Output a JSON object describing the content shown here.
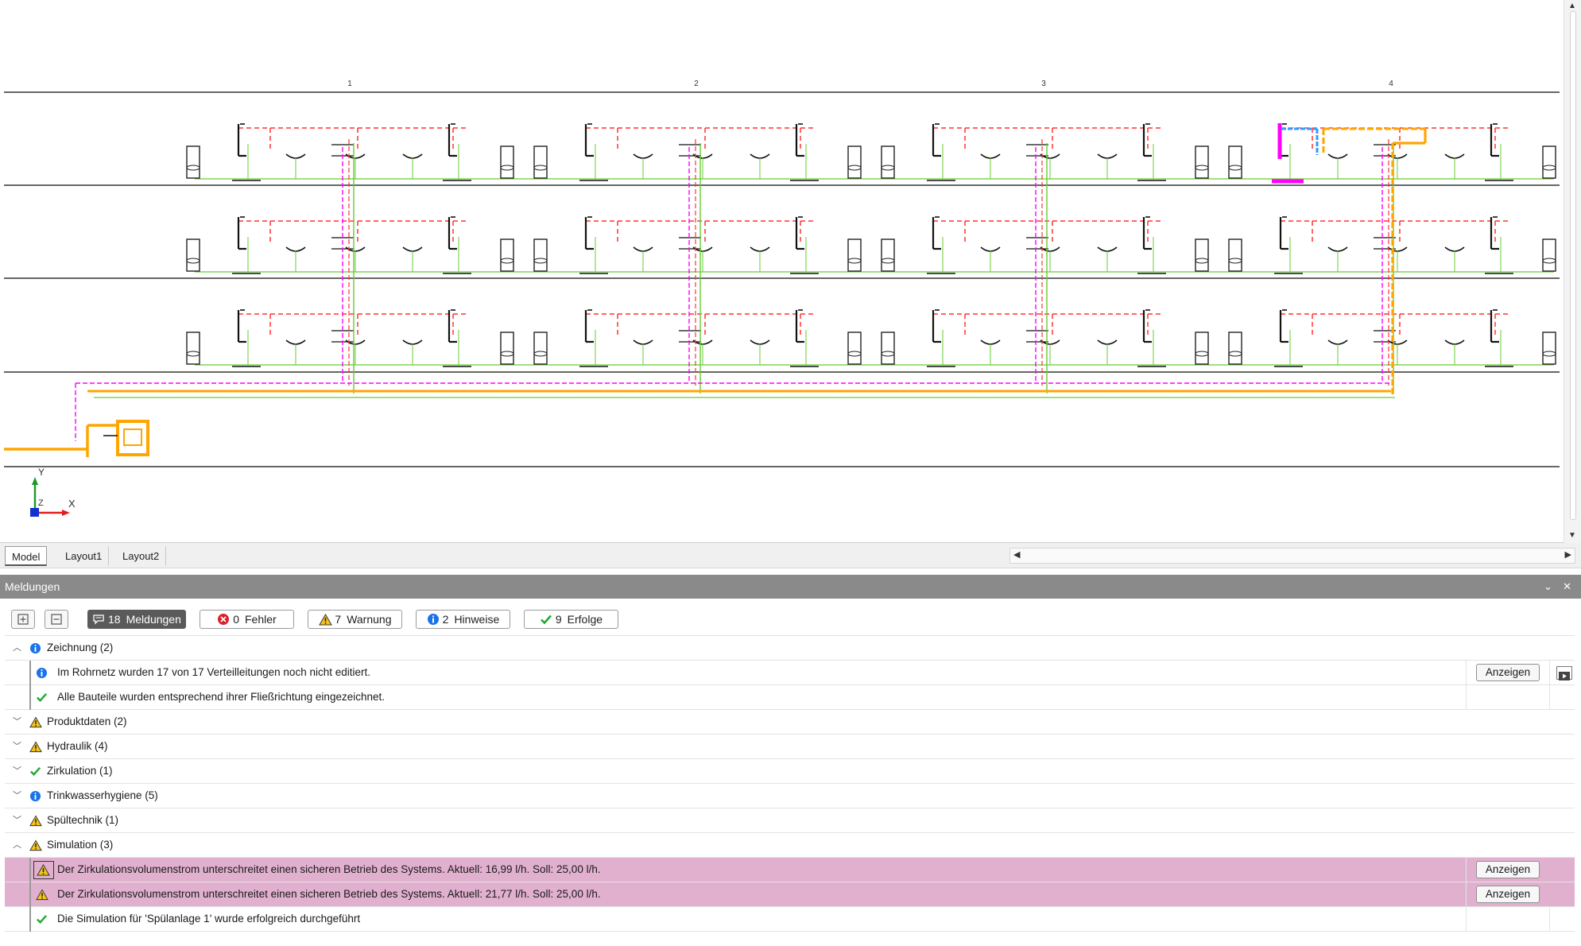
{
  "drawing": {
    "axis_labels": [
      "1",
      "2",
      "3",
      "4"
    ],
    "ucs_x": "X",
    "ucs_y": "Y",
    "ucs_z": "Z"
  },
  "layout_tabs": [
    {
      "label": "Model",
      "active": true
    },
    {
      "label": "Layout1",
      "active": false
    },
    {
      "label": "Layout2",
      "active": false
    }
  ],
  "panel": {
    "title": "Meldungen",
    "filters": {
      "messages": {
        "count": "18",
        "label": "Meldungen"
      },
      "errors": {
        "count": "0",
        "label": "Fehler"
      },
      "warnings": {
        "count": "7",
        "label": "Warnung"
      },
      "hints": {
        "count": "2",
        "label": "Hinweise"
      },
      "successes": {
        "count": "9",
        "label": "Erfolge"
      }
    },
    "show_label": "Anzeigen",
    "groups": [
      {
        "label": "Zeichnung (2)",
        "icon": "info-icon",
        "expanded": true
      },
      {
        "label": "Produktdaten (2)",
        "icon": "warning-icon",
        "expanded": false
      },
      {
        "label": "Hydraulik (4)",
        "icon": "warning-icon",
        "expanded": false
      },
      {
        "label": "Zirkulation (1)",
        "icon": "check-icon",
        "expanded": false
      },
      {
        "label": "Trinkwasserhygiene (5)",
        "icon": "info-icon",
        "expanded": false
      },
      {
        "label": "Spültechnik (1)",
        "icon": "warning-icon",
        "expanded": false
      },
      {
        "label": "Simulation (3)",
        "icon": "warning-icon",
        "expanded": true
      }
    ],
    "zeichnung_items": [
      {
        "text": "Im Rohrnetz wurden 17 von 17 Verteilleitungen noch nicht editiert.",
        "icon": "info-icon"
      },
      {
        "text": "Alle Bauteile wurden entsprechend ihrer Fließrichtung eingezeichnet.",
        "icon": "check-icon"
      }
    ],
    "simulation_items": [
      {
        "text": "Der Zirkulationsvolumenstrom unterschreitet einen sicheren Betrieb des Systems. Aktuell: 16,99 l/h. Soll: 25,00 l/h.",
        "icon": "warning-icon"
      },
      {
        "text": "Der Zirkulationsvolumenstrom unterschreitet einen sicheren Betrieb des Systems. Aktuell: 21,77 l/h. Soll: 25,00 l/h.",
        "icon": "warning-icon"
      },
      {
        "text": "Die Simulation für 'Spülanlage 1' wurde erfolgreich durchgeführt",
        "icon": "check-icon"
      }
    ]
  },
  "colors": {
    "cold_water": "#66cc33",
    "hot_water": "#ff3333",
    "circulation": "#ff00ff",
    "main_pipe": "#ffa500",
    "blue_pipe": "#3399ff",
    "highlight_row": "#e1b0cf"
  }
}
